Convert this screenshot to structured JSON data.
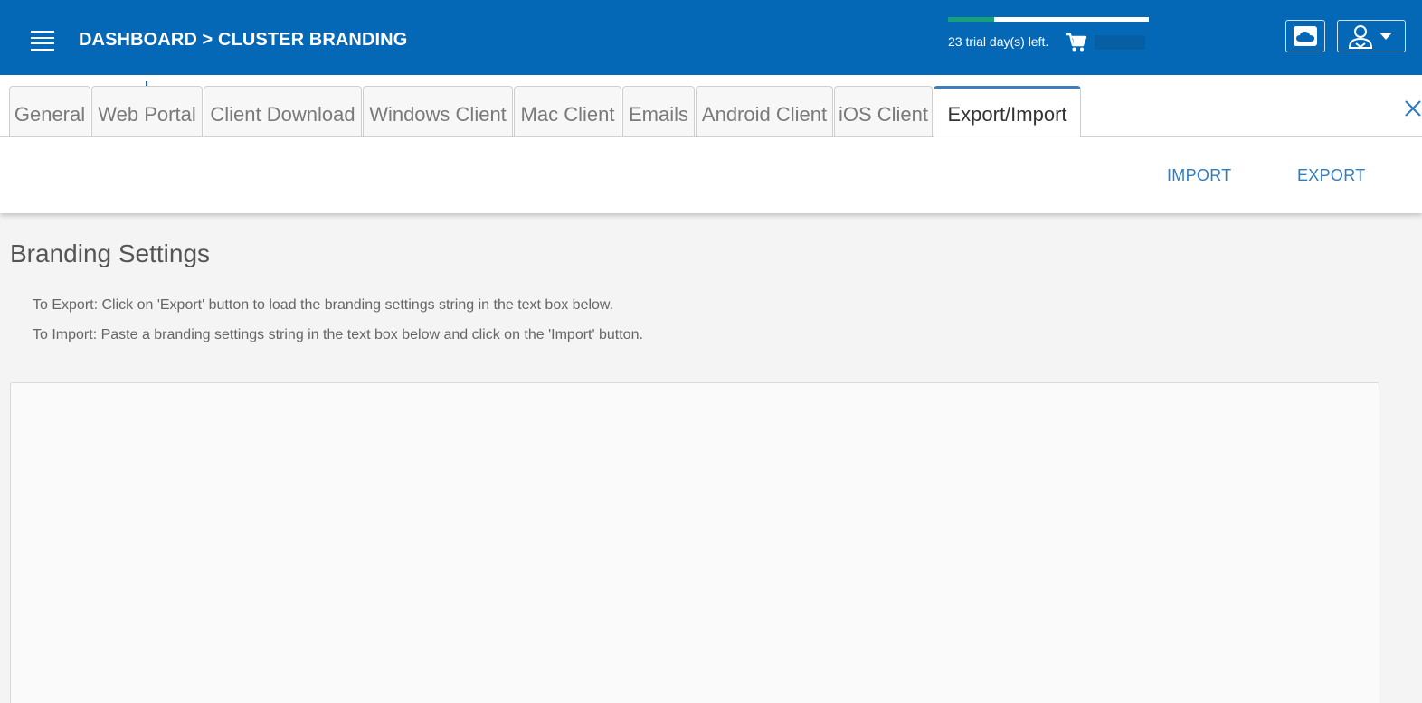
{
  "header": {
    "breadcrumb": "DASHBOARD > CLUSTER BRANDING",
    "trial": {
      "text": "23 trial day(s) left.",
      "progress_fraction": 0.23
    },
    "icons": [
      "menu-icon",
      "cart-icon",
      "cloud-icon",
      "user-icon",
      "caret-down-icon"
    ]
  },
  "tabs": [
    {
      "label": "General",
      "active": false
    },
    {
      "label": "Web Portal",
      "active": false
    },
    {
      "label": "Client Download",
      "active": false
    },
    {
      "label": "Windows Client",
      "active": false
    },
    {
      "label": "Mac Client",
      "active": false
    },
    {
      "label": "Emails",
      "active": false
    },
    {
      "label": "Android Client",
      "active": false
    },
    {
      "label": "iOS Client",
      "active": false
    },
    {
      "label": "Export/Import",
      "active": true
    }
  ],
  "actions": {
    "import_label": "IMPORT",
    "export_label": "EXPORT"
  },
  "content": {
    "title": "Branding Settings",
    "export_help": "To Export: Click on 'Export' button to load the branding settings string in the text box below.",
    "import_help": "To Import: Paste a branding settings string in the text box below and click on the 'Import' button.",
    "settings_value": ""
  },
  "colors": {
    "header_bg": "#0468b6",
    "accent_link": "#2e7dc0",
    "trial_progress": "#18a07a"
  }
}
